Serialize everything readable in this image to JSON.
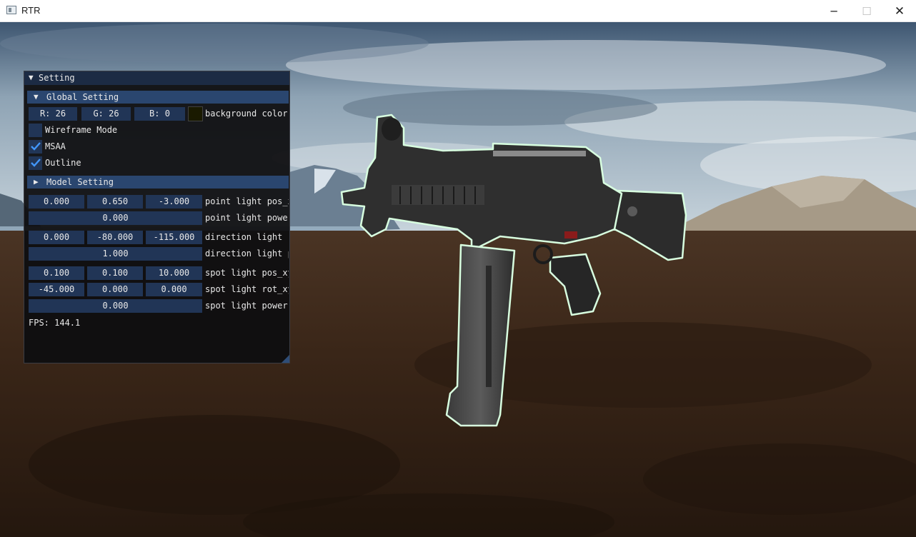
{
  "window": {
    "title": "RTR",
    "minimize_glyph": "─",
    "maximize_glyph": "☐",
    "close_glyph": "✕"
  },
  "panel": {
    "title": "Setting",
    "expanded_arrow": "▼",
    "collapsed_arrow": "▶",
    "global": {
      "header": "Global Setting",
      "bg_r": "R: 26",
      "bg_g": "G: 26",
      "bg_b": "B:  0",
      "bg_label": "background color",
      "swatch_color": "#1a1a00",
      "wireframe_label": "Wireframe Mode",
      "wireframe_checked": false,
      "msaa_label": "MSAA",
      "msaa_checked": true,
      "outline_label": "Outline",
      "outline_checked": true
    },
    "model": {
      "header": "Model Setting",
      "point_pos": [
        "0.000",
        "0.650",
        "-3.000"
      ],
      "point_pos_label": "point light pos_xyz",
      "point_power": "0.000",
      "point_power_label": "point light power",
      "dir_rot": [
        "0.000",
        "-80.000",
        "-115.000"
      ],
      "dir_rot_label": "direction light rot_xyz",
      "dir_power": "1.000",
      "dir_power_label": "direction light power",
      "spot_pos": [
        "0.100",
        "0.100",
        "10.000"
      ],
      "spot_pos_label": "spot light pos_xyz",
      "spot_rot": [
        "-45.000",
        "0.000",
        "0.000"
      ],
      "spot_rot_label": "spot light rot_xyz",
      "spot_power": "0.000",
      "spot_power_label": "spot light power"
    },
    "fps": "FPS: 144.1"
  },
  "colors": {
    "accent": "#2a466f",
    "field": "#213556",
    "check": "#4296fa",
    "outline_glow": "#d8ffe0"
  }
}
